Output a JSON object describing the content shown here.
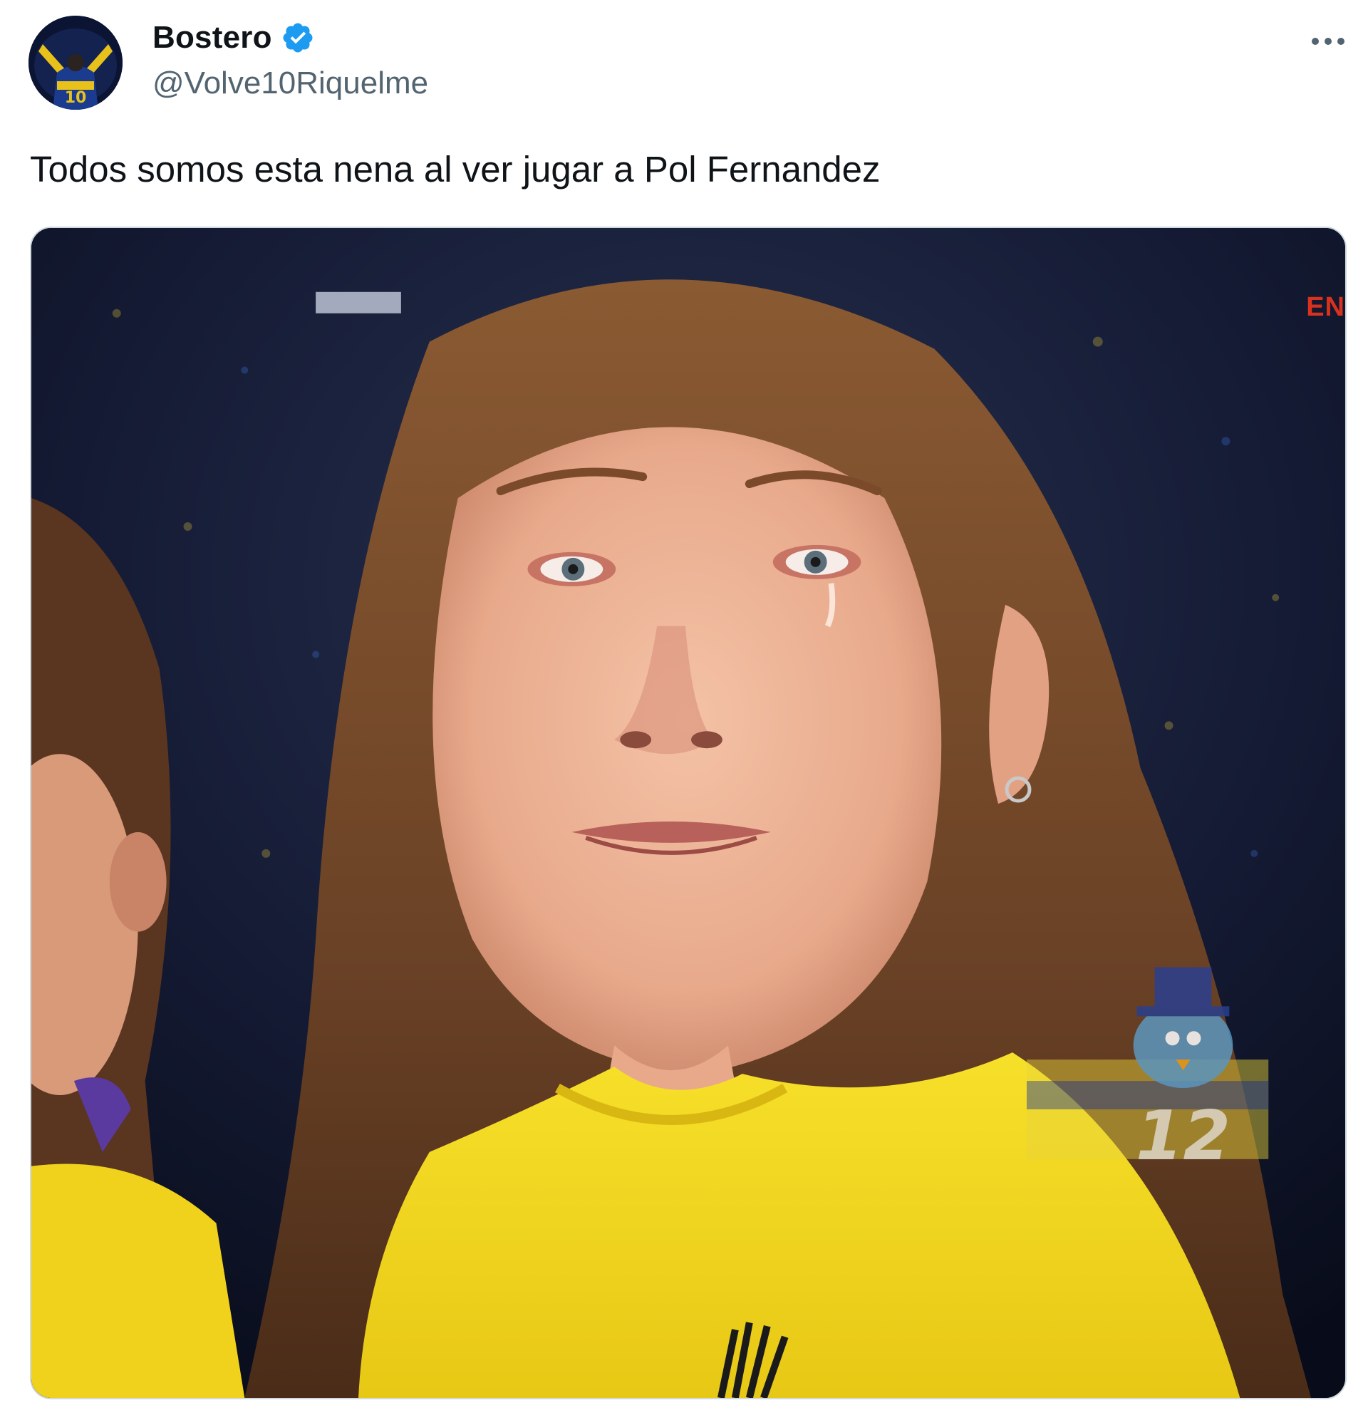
{
  "tweet": {
    "author": {
      "display_name": "Bostero",
      "handle": "@Volve10Riquelme",
      "verified": true,
      "avatar_icon": "avatar-image"
    },
    "more_icon": "more-options-icon",
    "text": "Todos somos esta nena al ver jugar a Pol Fernandez",
    "media": {
      "corner_text": "EN",
      "watermark_number": "12"
    }
  },
  "colors": {
    "name": "#0f1419",
    "handle": "#536471",
    "verified": "#1d9bf0",
    "border": "#cfd9de",
    "jersey": "#f3d21a"
  }
}
